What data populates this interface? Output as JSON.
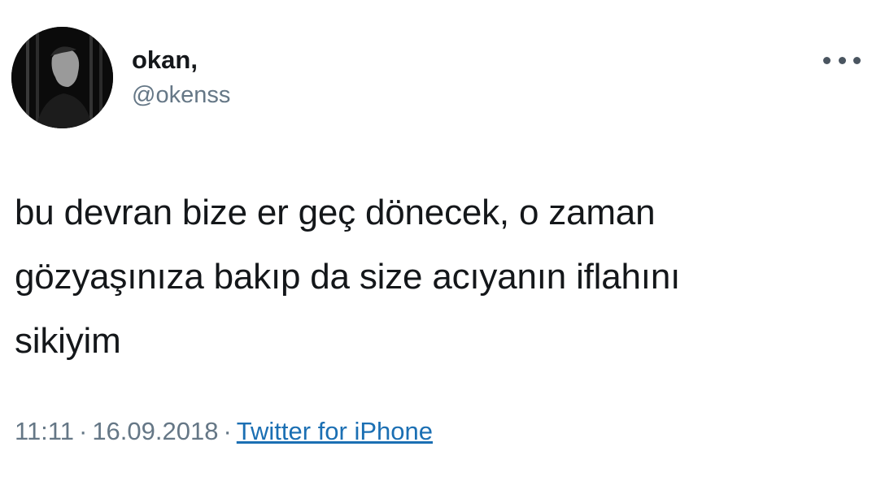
{
  "user": {
    "display_name": "okan,",
    "handle": "@okenss"
  },
  "menu": {
    "icon": "more-horizontal-icon"
  },
  "tweet": {
    "lines": [
      "bu devran bize er geç dönecek, o zaman",
      "gözyaşınıza bakıp da size acıyanın iflahını",
      "sikiyim"
    ]
  },
  "meta": {
    "time": "11:11",
    "separator": "·",
    "date": "16.09.2018",
    "source": "Twitter for iPhone"
  },
  "colors": {
    "text": "#14171a",
    "muted": "#657786",
    "link": "#1b6fb3"
  }
}
